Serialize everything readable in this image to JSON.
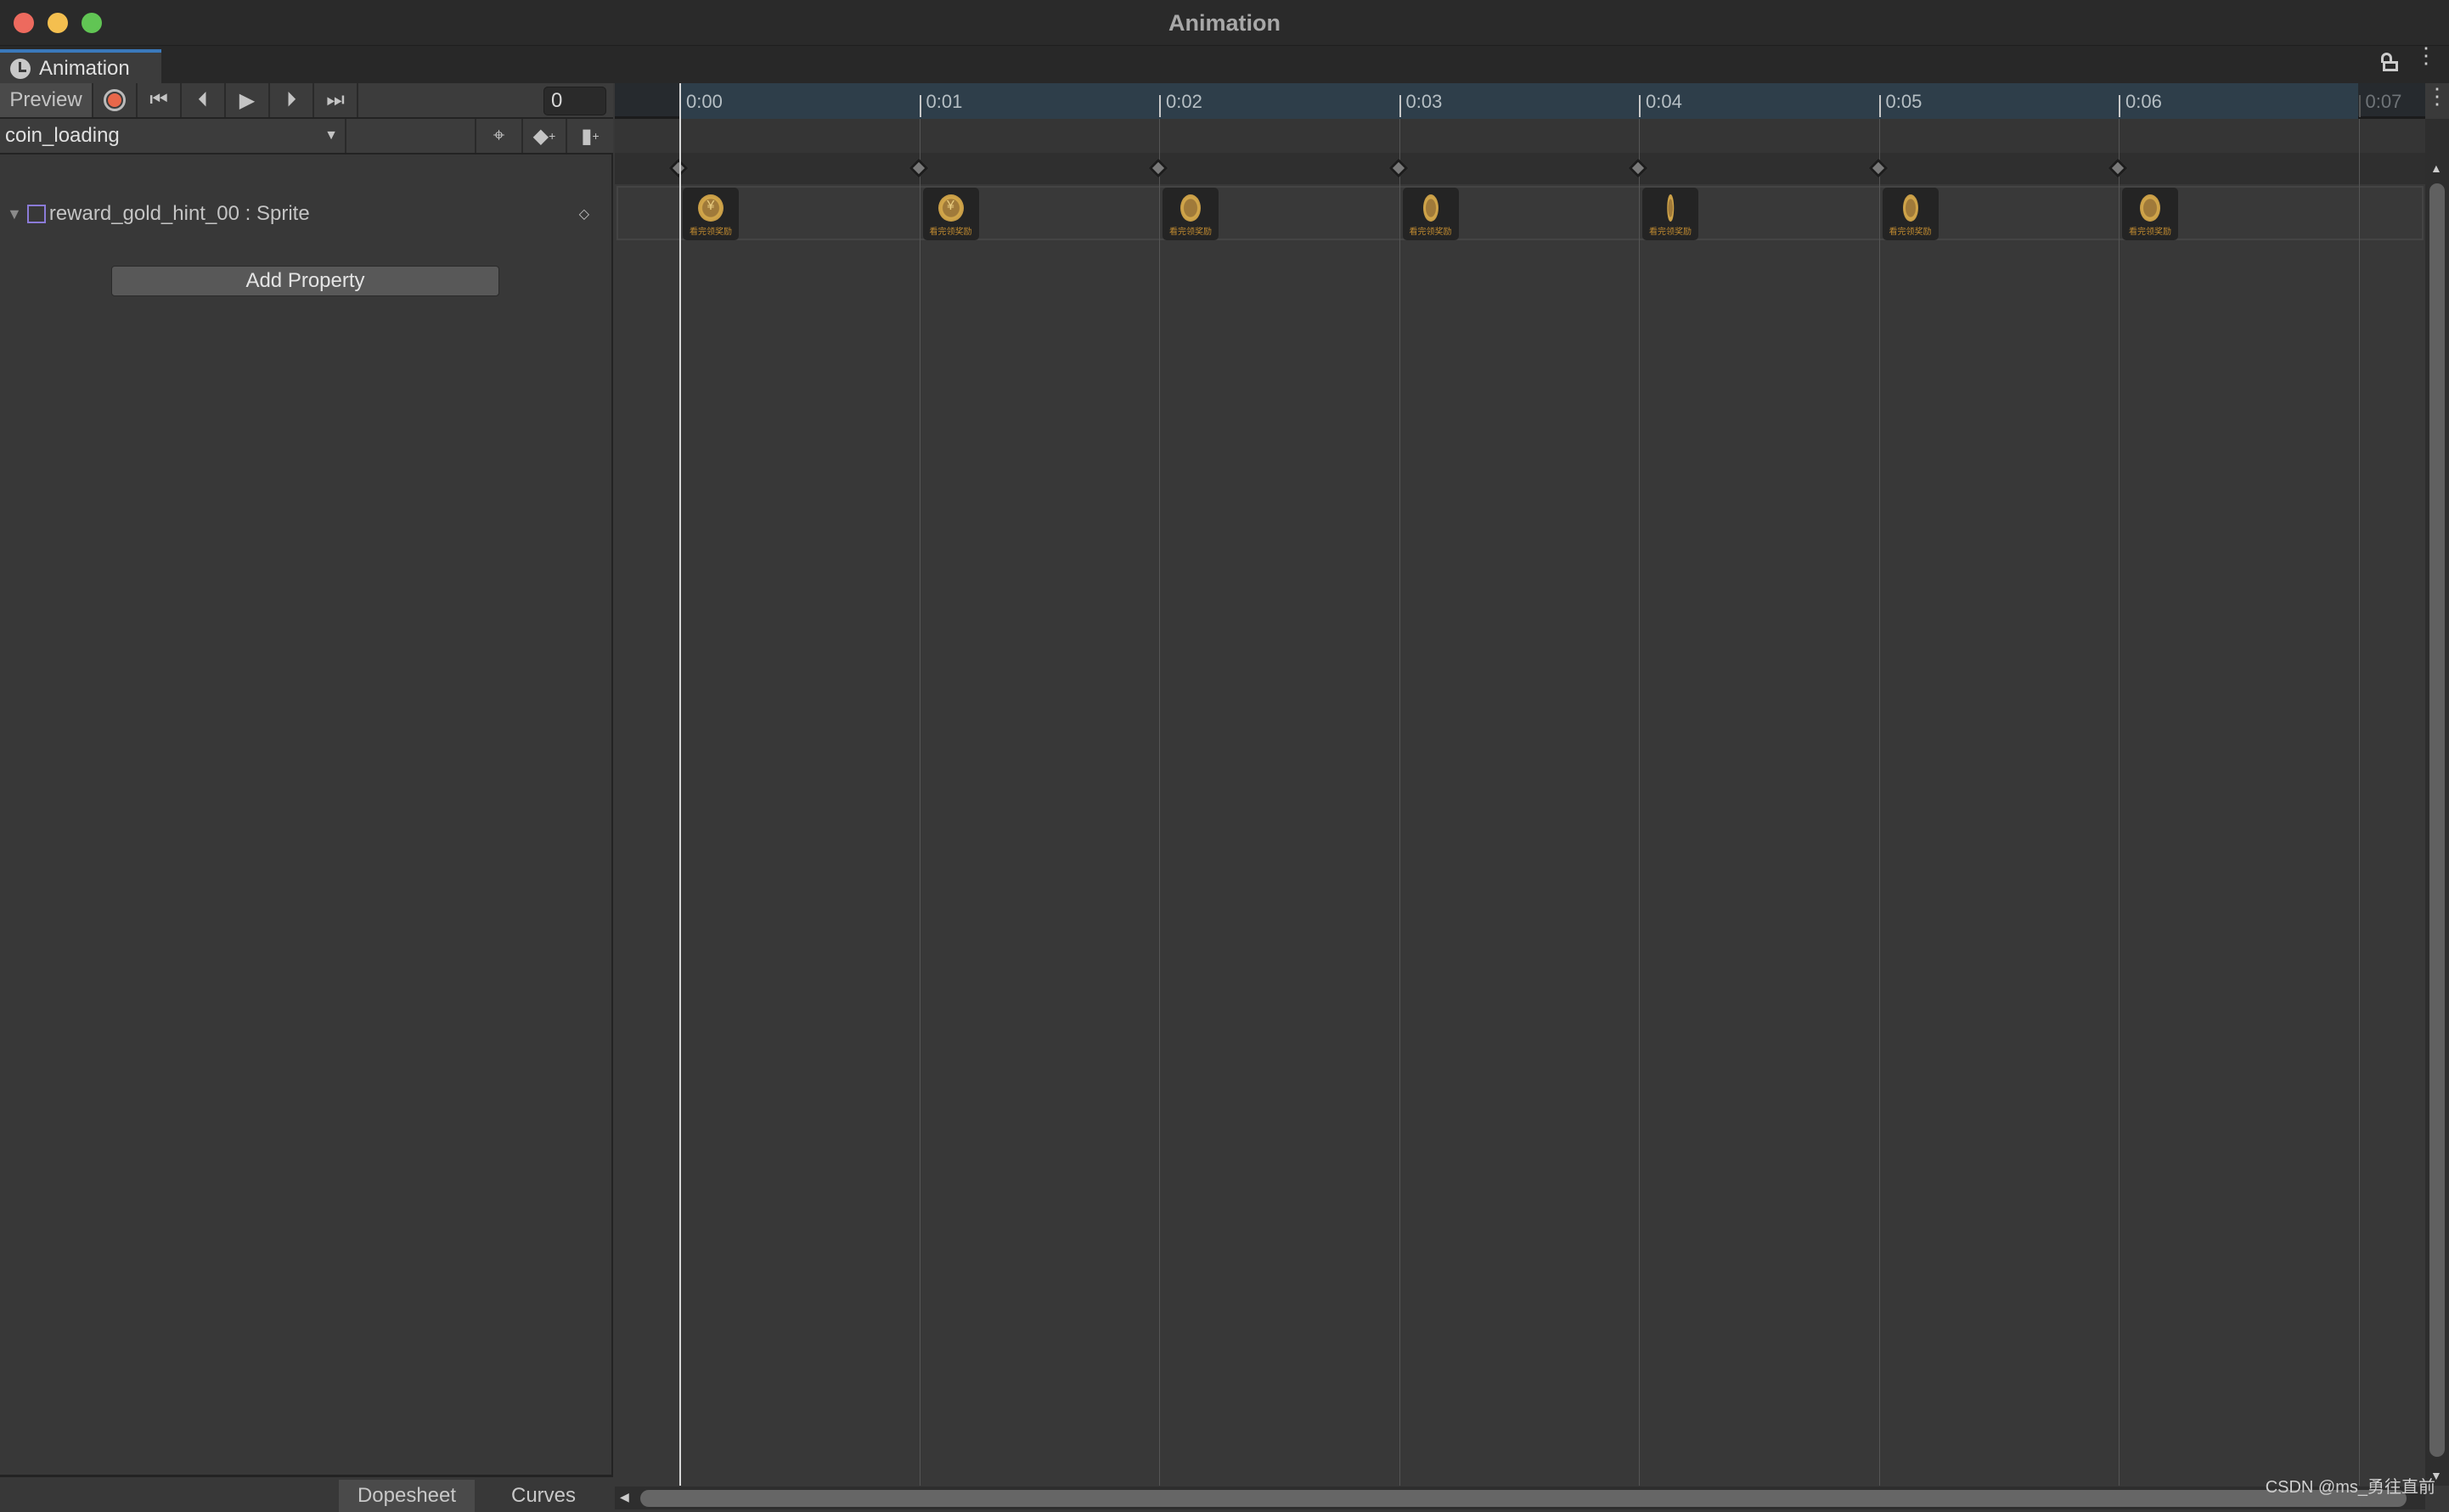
{
  "window": {
    "title": "Animation",
    "traffic_lights": [
      "#ed6a5e",
      "#f4bf4f",
      "#61c554"
    ]
  },
  "tab": {
    "label": "Animation",
    "icon": "clock-icon"
  },
  "toolbar": {
    "preview_label": "Preview",
    "record_color": "#e8674a",
    "frame_value": "0"
  },
  "clip": {
    "selected": "coin_loading"
  },
  "property": {
    "label": "reward_gold_hint_00 : Sprite"
  },
  "add_property_label": "Add Property",
  "bottom_tabs": [
    "Dopesheet",
    "Curves"
  ],
  "timeline": {
    "ticks": [
      "0:00",
      "0:01",
      "0:02",
      "0:03",
      "0:04",
      "0:05",
      "0:06",
      "0:07"
    ],
    "accent": "#2e3e4a",
    "sprite_frames": [
      {
        "time": "0:00",
        "caption": "看完领奖励",
        "coin_width_fraction": 1.0
      },
      {
        "time": "0:01",
        "caption": "看完领奖励",
        "coin_width_fraction": 1.0
      },
      {
        "time": "0:02",
        "caption": "看完领奖励",
        "coin_width_fraction": 0.8
      },
      {
        "time": "0:03",
        "caption": "看完领奖励",
        "coin_width_fraction": 0.6
      },
      {
        "time": "0:04",
        "caption": "看完领奖励",
        "coin_width_fraction": 0.25
      },
      {
        "time": "0:05",
        "caption": "看完领奖励",
        "coin_width_fraction": 0.6
      },
      {
        "time": "0:06",
        "caption": "看完领奖励",
        "coin_width_fraction": 0.8
      }
    ]
  },
  "watermark": "CSDN @ms_勇往直前"
}
